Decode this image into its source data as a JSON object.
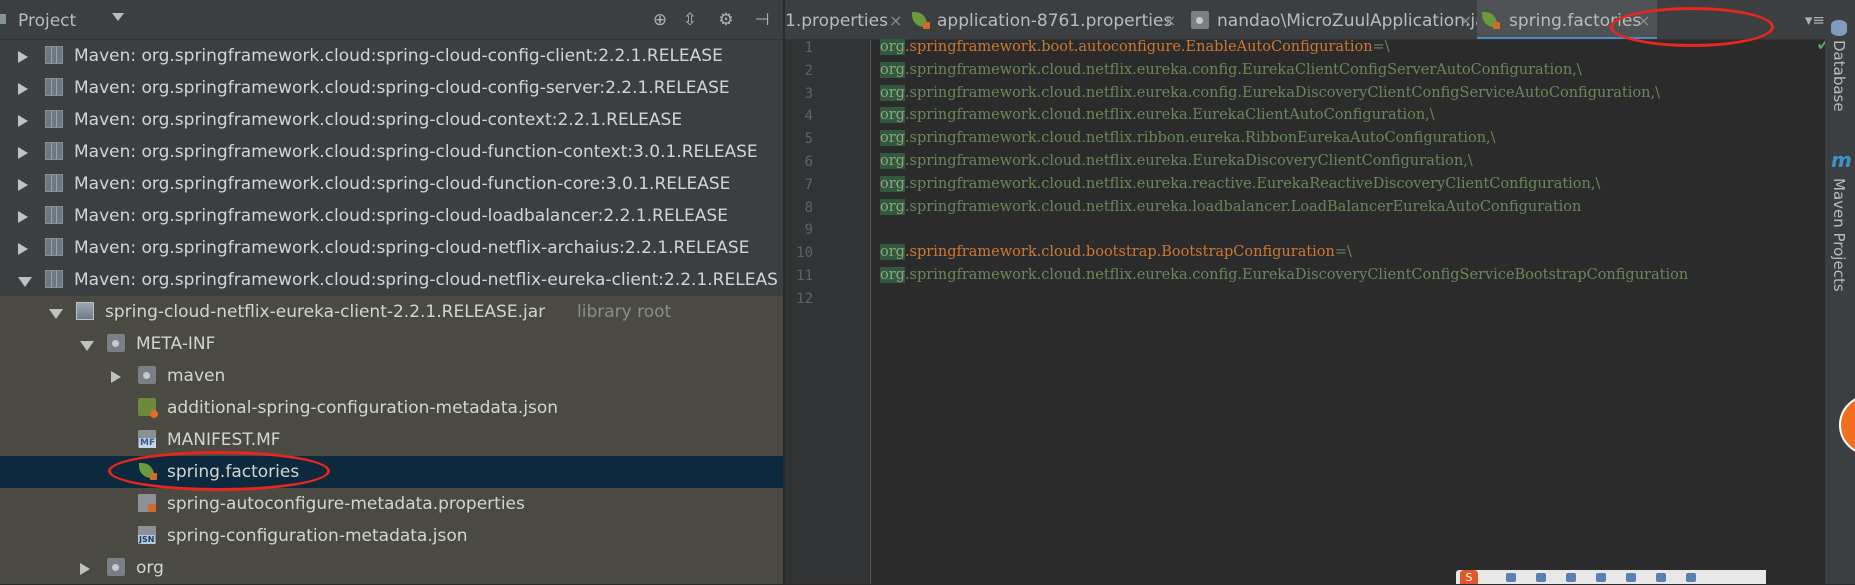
{
  "project_panel": {
    "title": "Project",
    "tree": [
      {
        "label": "Maven: org.springframework.cloud:spring-cloud-config-client:2.2.1.RELEASE",
        "icon": "library-icon",
        "depth": 0,
        "arrow": "right"
      },
      {
        "label": "Maven: org.springframework.cloud:spring-cloud-config-server:2.2.1.RELEASE",
        "icon": "library-icon",
        "depth": 0,
        "arrow": "right"
      },
      {
        "label": "Maven: org.springframework.cloud:spring-cloud-context:2.2.1.RELEASE",
        "icon": "library-icon",
        "depth": 0,
        "arrow": "right"
      },
      {
        "label": "Maven: org.springframework.cloud:spring-cloud-function-context:3.0.1.RELEASE",
        "icon": "library-icon",
        "depth": 0,
        "arrow": "right"
      },
      {
        "label": "Maven: org.springframework.cloud:spring-cloud-function-core:3.0.1.RELEASE",
        "icon": "library-icon",
        "depth": 0,
        "arrow": "right"
      },
      {
        "label": "Maven: org.springframework.cloud:spring-cloud-loadbalancer:2.2.1.RELEASE",
        "icon": "library-icon",
        "depth": 0,
        "arrow": "right"
      },
      {
        "label": "Maven: org.springframework.cloud:spring-cloud-netflix-archaius:2.2.1.RELEASE",
        "icon": "library-icon",
        "depth": 0,
        "arrow": "right"
      },
      {
        "label": "Maven: org.springframework.cloud:spring-cloud-netflix-eureka-client:2.2.1.RELEAS",
        "icon": "library-icon",
        "depth": 0,
        "arrow": "down"
      },
      {
        "label": "spring-cloud-netflix-eureka-client-2.2.1.RELEASE.jar",
        "sub": "library root",
        "icon": "jar-icon",
        "depth": 1,
        "arrow": "down"
      },
      {
        "label": "META-INF",
        "icon": "package-icon",
        "depth": 2,
        "arrow": "down"
      },
      {
        "label": "maven",
        "icon": "package-icon",
        "depth": 3,
        "arrow": "right"
      },
      {
        "label": "additional-spring-configuration-metadata.json",
        "icon": "spring-json-icon",
        "depth": 3,
        "arrow": "none"
      },
      {
        "label": "MANIFEST.MF",
        "icon": "manifest-icon",
        "depth": 3,
        "arrow": "none"
      },
      {
        "label": "spring.factories",
        "icon": "spring-leaf-icon",
        "depth": 3,
        "arrow": "none",
        "selected": true
      },
      {
        "label": "spring-autoconfigure-metadata.properties",
        "icon": "properties-icon",
        "depth": 3,
        "arrow": "none"
      },
      {
        "label": "spring-configuration-metadata.json",
        "icon": "json-file-icon",
        "depth": 3,
        "arrow": "none"
      },
      {
        "label": "org",
        "icon": "package-icon",
        "depth": 2,
        "arrow": "right"
      }
    ]
  },
  "tabs": [
    {
      "label": "1.properties",
      "close": "×",
      "icon": "none"
    },
    {
      "label": "application-8761.properties",
      "close": "×",
      "icon": "spring-leaf-icon"
    },
    {
      "label": "nandao\\MicroZuulApplication.java",
      "close": "×",
      "icon": "spring-boot-class-icon"
    },
    {
      "label": "spring.factories",
      "close": "×",
      "icon": "spring-leaf-icon",
      "active": true
    }
  ],
  "tab_overflow": "▾≡",
  "editor": {
    "lines": [
      {
        "n": "1",
        "parts": [
          {
            "t": "org",
            "c": "mark"
          },
          {
            "t": ".springframework.boot.autoconfigure.EnableAutoConfiguration",
            "c": "k"
          },
          {
            "t": "=\\",
            "c": "v"
          }
        ]
      },
      {
        "n": "2",
        "parts": [
          {
            "t": "org",
            "c": "mark"
          },
          {
            "t": ".springframework.cloud.netflix.eureka.config.EurekaClientConfigServerAutoConfiguration,\\",
            "c": "v"
          }
        ]
      },
      {
        "n": "3",
        "parts": [
          {
            "t": "org",
            "c": "mark"
          },
          {
            "t": ".springframework.cloud.netflix.eureka.config.EurekaDiscoveryClientConfigServiceAutoConfiguration,\\",
            "c": "v"
          }
        ]
      },
      {
        "n": "4",
        "parts": [
          {
            "t": "org",
            "c": "mark"
          },
          {
            "t": ".springframework.cloud.netflix.eureka.EurekaClientAutoConfiguration,\\",
            "c": "v"
          }
        ]
      },
      {
        "n": "5",
        "parts": [
          {
            "t": "org",
            "c": "mark"
          },
          {
            "t": ".springframework.cloud.netflix.ribbon.eureka.RibbonEurekaAutoConfiguration,\\",
            "c": "v"
          }
        ]
      },
      {
        "n": "6",
        "parts": [
          {
            "t": "org",
            "c": "mark"
          },
          {
            "t": ".springframework.cloud.netflix.eureka.EurekaDiscoveryClientConfiguration,\\",
            "c": "v"
          }
        ]
      },
      {
        "n": "7",
        "parts": [
          {
            "t": "org",
            "c": "mark"
          },
          {
            "t": ".springframework.cloud.netflix.eureka.reactive.EurekaReactiveDiscoveryClientConfiguration,\\",
            "c": "v"
          }
        ]
      },
      {
        "n": "8",
        "parts": [
          {
            "t": "org",
            "c": "mark"
          },
          {
            "t": ".springframework.cloud.netflix.eureka.loadbalancer.LoadBalancerEurekaAutoConfiguration",
            "c": "v"
          }
        ]
      },
      {
        "n": "9",
        "parts": []
      },
      {
        "n": "10",
        "parts": [
          {
            "t": "org",
            "c": "mark"
          },
          {
            "t": ".springframework.cloud.bootstrap.BootstrapConfiguration",
            "c": "k"
          },
          {
            "t": "=\\",
            "c": "v"
          }
        ]
      },
      {
        "n": "11",
        "parts": [
          {
            "t": "org",
            "c": "mark"
          },
          {
            "t": ".springframework.cloud.netflix.eureka.config.EurekaDiscoveryClientConfigServiceBootstrapConfiguration",
            "c": "v"
          }
        ]
      },
      {
        "n": "12",
        "parts": []
      }
    ],
    "status_check": "✓"
  },
  "right_sidebar": {
    "database_label": "Database",
    "maven_label": "Maven Projects",
    "maven_glyph": "m"
  },
  "colors": {
    "annotation_circle": "#e8261e",
    "selection": "#0d293e",
    "keyword": "#cc7832",
    "value": "#6a8759"
  }
}
